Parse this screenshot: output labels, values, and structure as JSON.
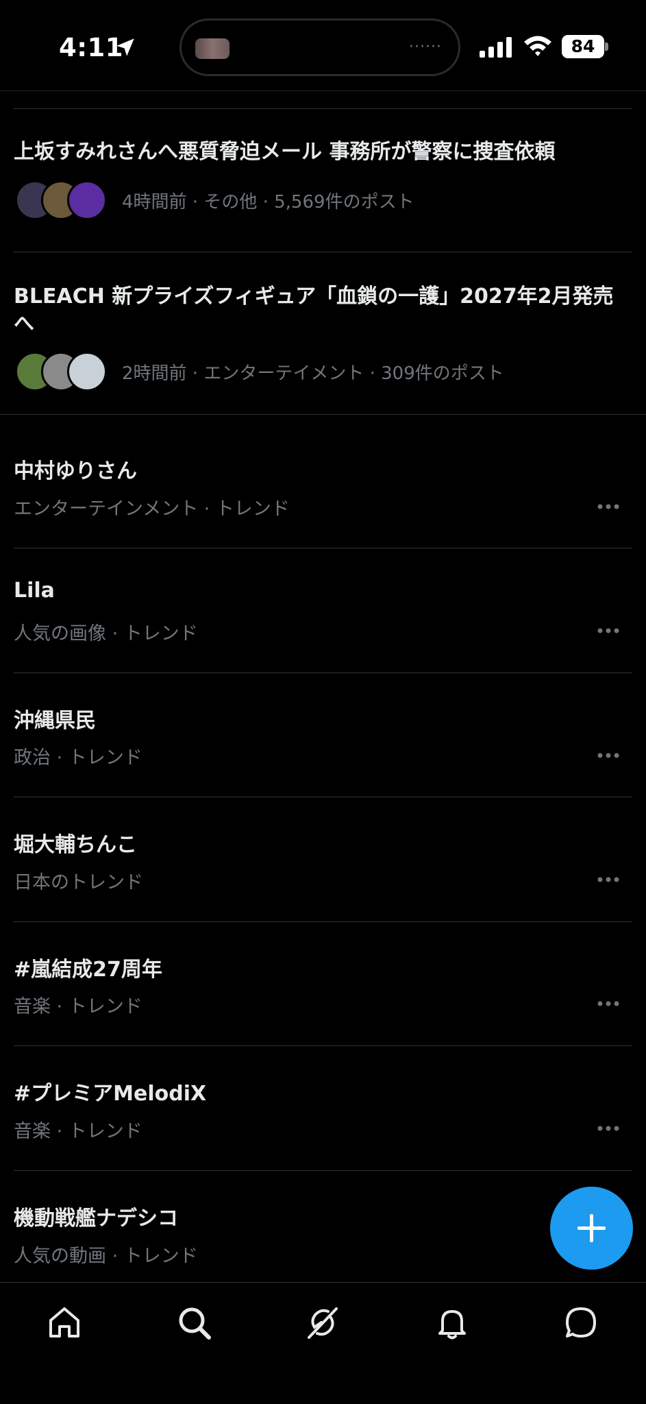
{
  "status_bar": {
    "time": "4:11",
    "battery_level": "84"
  },
  "news": [
    {
      "title": "上坂すみれさんへ悪質脅迫メール 事務所が警察に捜査依頼",
      "meta": "4時間前 · その他 · 5,569件のポスト",
      "avatar_colors": [
        "#3a3550",
        "#6d5a3c",
        "#5a2da0"
      ]
    },
    {
      "title": "BLEACH 新プライズフィギュア「血鎖の一護」2027年2月発売へ",
      "meta": "2時間前 · エンターテイメント · 309件のポスト",
      "avatar_colors": [
        "#5a7a3a",
        "#8a8a8a",
        "#c8d0d8"
      ]
    }
  ],
  "trends": [
    {
      "title": "中村ゆりさん",
      "subtitle": "エンターテインメント · トレンド"
    },
    {
      "title": "Lila",
      "subtitle": "人気の画像 · トレンド"
    },
    {
      "title": "沖縄県民",
      "subtitle": "政治 · トレンド"
    },
    {
      "title": "堀大輔ちんこ",
      "subtitle": "日本のトレンド"
    },
    {
      "title": "#嵐結成27周年",
      "subtitle": "音楽 · トレンド"
    },
    {
      "title": "#プレミアMelodiX",
      "subtitle": "音楽 · トレンド"
    },
    {
      "title": "機動戦艦ナデシコ",
      "subtitle": "人気の動画 · トレンド"
    }
  ],
  "colors": {
    "accent": "#1d9bf0",
    "background": "#000000",
    "text_primary": "#e7e9ea",
    "text_secondary": "#71767b"
  },
  "tab_bar": {
    "tabs": [
      "home-icon",
      "search-icon",
      "grok-icon",
      "notifications-icon",
      "messages-icon"
    ]
  },
  "fab": {
    "icon": "plus-icon"
  }
}
